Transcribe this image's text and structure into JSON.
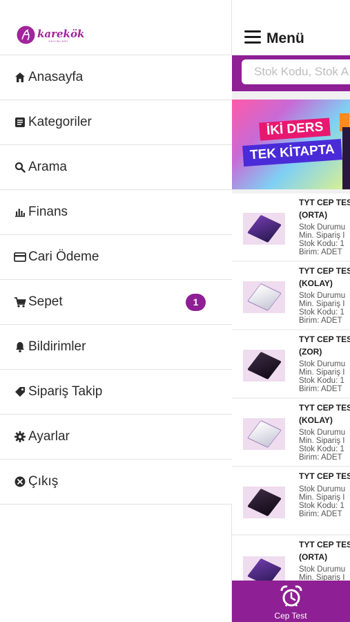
{
  "brand": {
    "logo_text": "karekök",
    "logo_sub": "YAYINLARI",
    "accent_color": "#8e1f94",
    "logo_color": "#a1249a"
  },
  "drawer": {
    "items": [
      {
        "label": "Anasayfa",
        "icon": "home-icon"
      },
      {
        "label": "Kategoriler",
        "icon": "list-icon"
      },
      {
        "label": "Arama",
        "icon": "search-icon"
      },
      {
        "label": "Finans",
        "icon": "bar-chart-icon"
      },
      {
        "label": "Cari Ödeme",
        "icon": "credit-card-icon"
      },
      {
        "label": "Sepet",
        "icon": "cart-icon",
        "badge": "1"
      },
      {
        "label": "Bildirimler",
        "icon": "bell-icon"
      },
      {
        "label": "Sipariş Takip",
        "icon": "tag-icon"
      },
      {
        "label": "Ayarlar",
        "icon": "gear-icon"
      },
      {
        "label": "Çıkış",
        "icon": "close-circle-icon"
      }
    ]
  },
  "header": {
    "title": "Menü",
    "menu_icon": "hamburger-icon"
  },
  "search": {
    "placeholder": "Stok Kodu, Stok A"
  },
  "banner": {
    "line1": "İKİ DERS",
    "line2": "TEK KİTAPTA"
  },
  "products": [
    {
      "name1": "TYT CEP TES",
      "name2": "(ORTA)",
      "d1": "Stok Durumu",
      "d2": "Min. Sipariş I",
      "d3": "Stok Kodu: 1",
      "d4": "Birim: ADET"
    },
    {
      "name1": "TYT CEP TES",
      "name2": "(KOLAY)",
      "d1": "Stok Durumu",
      "d2": "Min. Sipariş I",
      "d3": "Stok Kodu: 1",
      "d4": "Birim: ADET"
    },
    {
      "name1": "TYT CEP TES",
      "name2": "(ZOR)",
      "d1": "Stok Durumu",
      "d2": "Min. Sipariş I",
      "d3": "Stok Kodu: 1",
      "d4": "Birim: ADET"
    },
    {
      "name1": "TYT CEP TES",
      "name2": "(KOLAY)",
      "d1": "Stok Durumu",
      "d2": "Min. Sipariş I",
      "d3": "Stok Kodu: 1",
      "d4": "Birim: ADET"
    },
    {
      "name1": "TYT CEP TES",
      "name2": "",
      "d1": "Stok Durumu",
      "d2": "Min. Sipariş I",
      "d3": "Stok Kodu: 1",
      "d4": "Birim: ADET"
    },
    {
      "name1": "TYT CEP TES",
      "name2": "(ORTA)",
      "d1": "Stok Durumu",
      "d2": "Min. Sipariş I",
      "d3": "",
      "d4": ""
    }
  ],
  "bottom_nav": {
    "label": "Cep Test",
    "icon": "alarm-clock-icon"
  }
}
